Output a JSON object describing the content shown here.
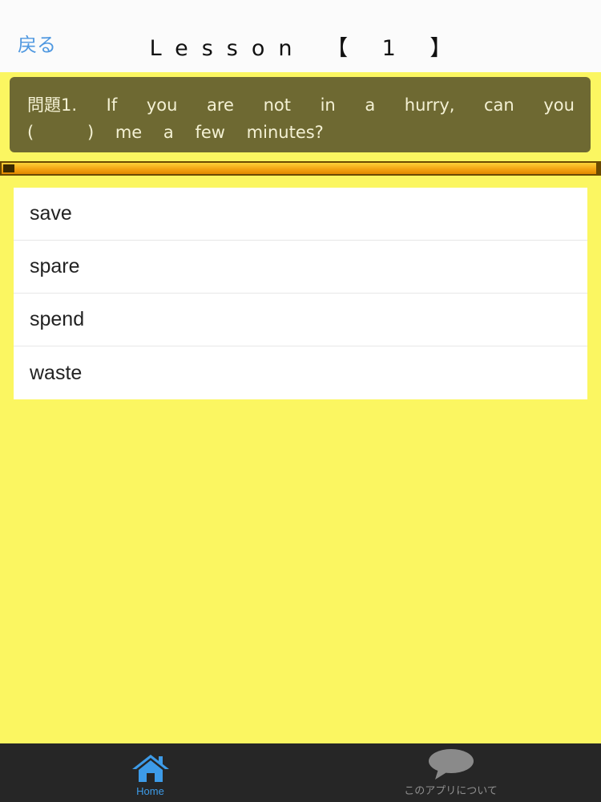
{
  "navbar": {
    "back_label": "戻る",
    "title": "Lesson 【 1 】"
  },
  "question": {
    "prefix": "問題1.",
    "line1_words": [
      "If",
      "you",
      "are",
      "not",
      "in",
      "a",
      "hurry,",
      "can",
      "you"
    ],
    "line2": "(          )    me    a    few    minutes?"
  },
  "progress": {
    "fraction": 0.995,
    "color": "#f2a010"
  },
  "answers": [
    "save",
    "spare",
    "spend",
    "waste"
  ],
  "tabbar": {
    "home_label": "Home",
    "home_icon": "house-icon",
    "about_label": "このアプリについて",
    "about_icon": "speech-bubble-icon"
  },
  "colors": {
    "background": "#fbf661",
    "question_box": "#6e6932",
    "back_link": "#4f98e0",
    "tab_active": "#3d9be8",
    "tab_bar": "#262626"
  }
}
